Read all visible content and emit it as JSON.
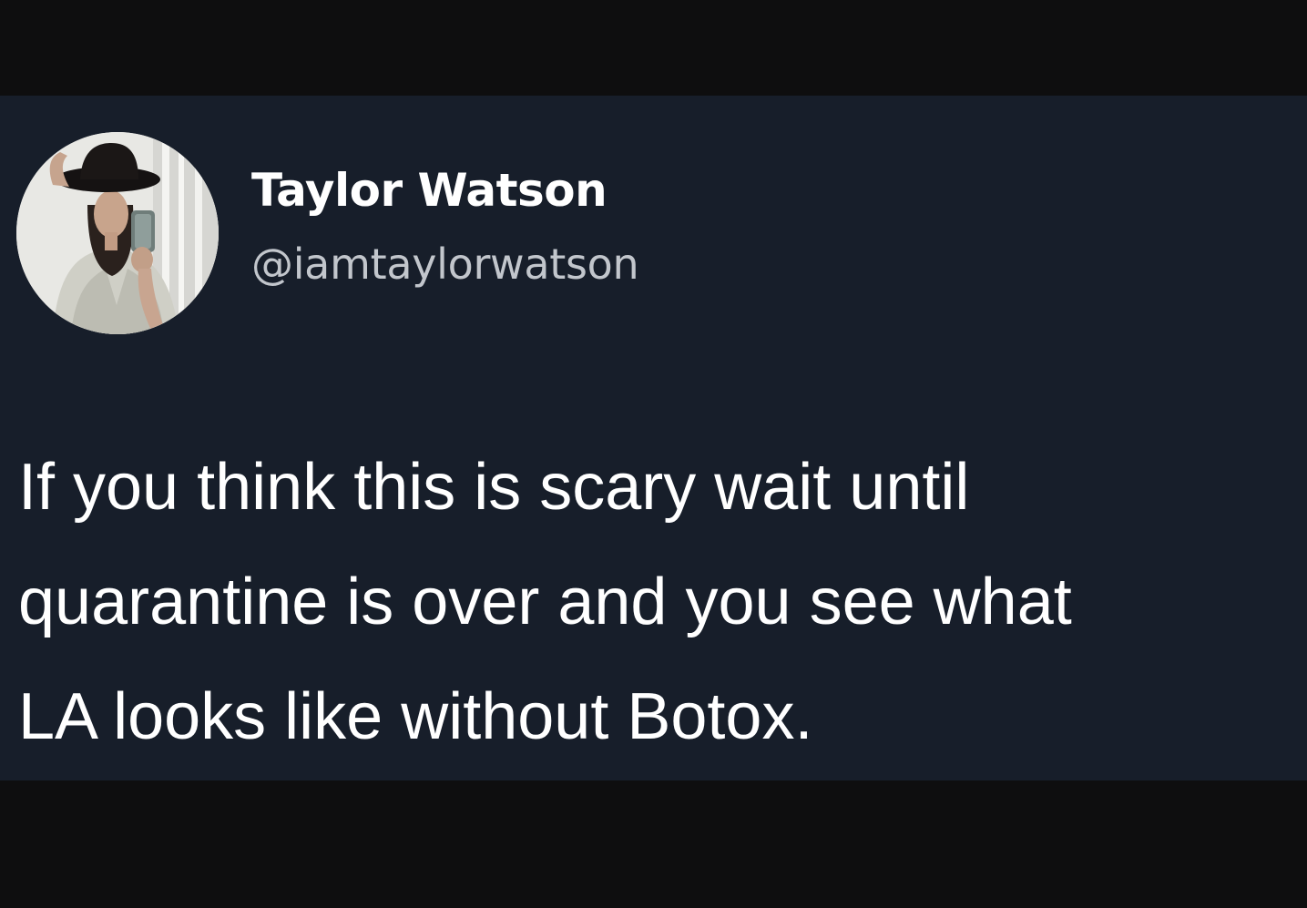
{
  "tweet": {
    "display_name": "Taylor Watson",
    "handle": "@iamtaylorwatson",
    "text_lines": [
      "If you think this is scary wait until",
      "quarantine is over and you see what",
      "LA looks like without Botox."
    ],
    "avatar_icon": "profile-photo"
  },
  "colors": {
    "outer_background": "#0e0e0f",
    "card_background": "#171e2a",
    "name_text": "#ffffff",
    "handle_text": "#c2c6cc",
    "body_text": "#ffffff"
  }
}
